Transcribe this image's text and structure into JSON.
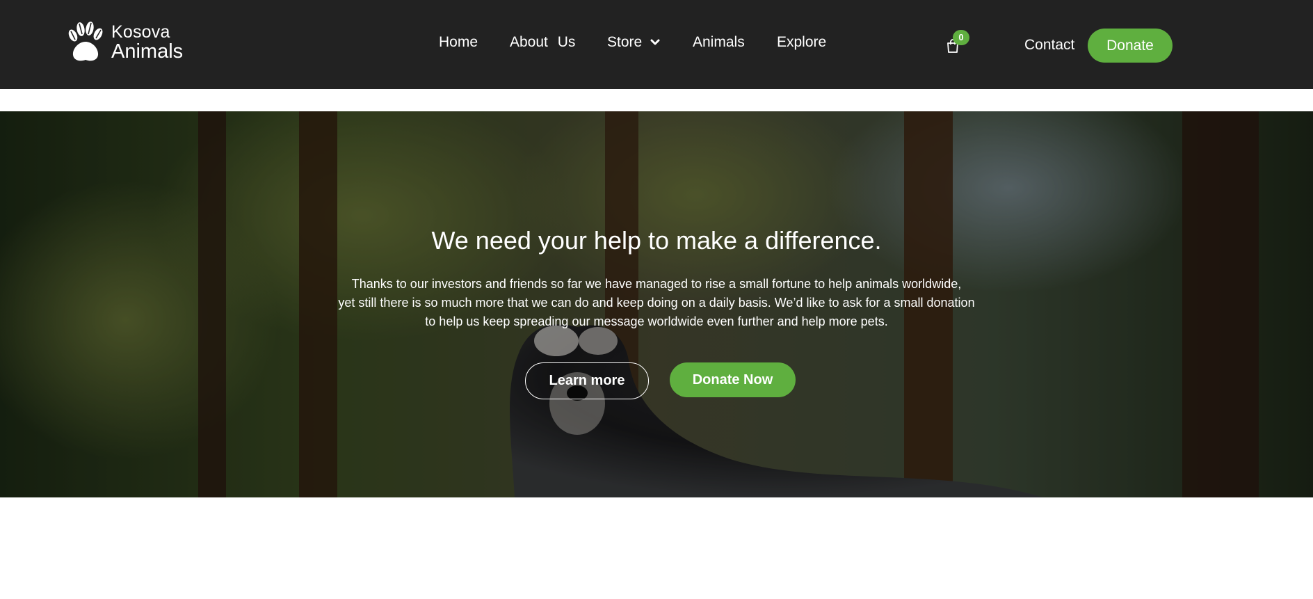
{
  "brand": {
    "line1": "Kosova",
    "line2": "Animals",
    "logo_icon": "paw-icon"
  },
  "nav": {
    "items": [
      {
        "label": "Home"
      },
      {
        "label": "About Us"
      },
      {
        "label": "Store",
        "icon": "chevron-down-icon"
      },
      {
        "label": "Animals"
      },
      {
        "label": "Explore"
      }
    ]
  },
  "cart": {
    "icon": "shopping-bag-icon",
    "count": "0"
  },
  "header_actions": {
    "contact_label": "Contact",
    "donate_label": "Donate"
  },
  "hero": {
    "title": "We need your help to make a difference.",
    "text_lines": [
      "Thanks to our investors and friends so far we have managed to rise a small fortune to help animals worldwide,",
      "yet still there is so much more that we can do and keep doing on a daily basis. We’d like to ask for a small donation",
      "to help us keep spreading our message worldwide even further and help more pets."
    ],
    "learn_more_label": "Learn more",
    "donate_now_label": "Donate Now"
  },
  "colors": {
    "header_bg": "#222222",
    "accent_green": "#5faf3f",
    "text_white": "#ffffff"
  }
}
